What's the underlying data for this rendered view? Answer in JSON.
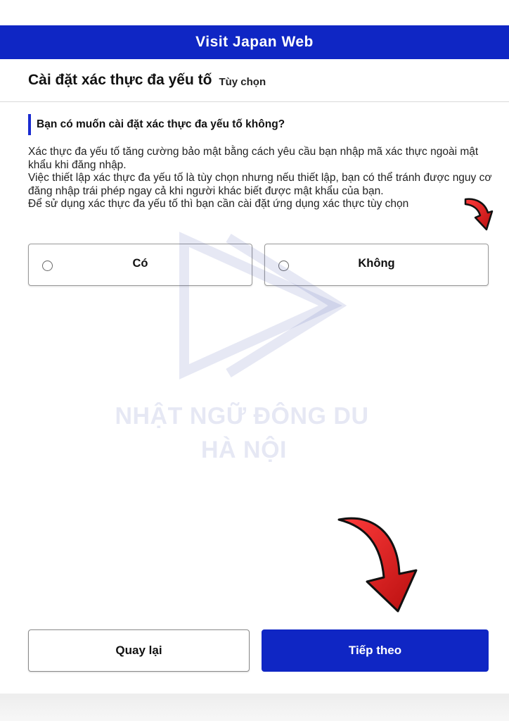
{
  "header": {
    "app_title": "Visit Japan Web"
  },
  "page": {
    "title": "Cài đặt xác thực đa yếu tố",
    "optional_label": "Tùy chọn"
  },
  "question": {
    "text": "Bạn có muốn cài đặt xác thực đa yếu tố không?"
  },
  "description": {
    "lines": [
      "Xác thực đa yếu tố tăng cường bảo mật bằng cách yêu cầu bạn nhập mã xác thực ngoài mật khẩu khi đăng nhập.",
      "Việc thiết lập xác thực đa yếu tố là tùy chọn nhưng nếu thiết lập, bạn có thể tránh được nguy cơ đăng nhập trái phép ngay cả khi người khác biết được mật khẩu của bạn.",
      "Để sử dụng xác thực đa yếu tố thì bạn cần cài đặt ứng dụng xác thực tùy chọn"
    ]
  },
  "options": {
    "yes_label": "Có",
    "no_label": "Không",
    "selected": "none"
  },
  "watermark": {
    "line1": "NHẬT NGỮ ĐÔNG DU",
    "line2": "HÀ NỘI",
    "icon": "play-logo-icon"
  },
  "buttons": {
    "back_label": "Quay lại",
    "next_label": "Tiếp theo"
  },
  "colors": {
    "brand_blue": "#0f26c4",
    "annotation_red": "#e01b1b"
  },
  "annotations": {
    "arrow_icon": "red-arrow-icon"
  }
}
